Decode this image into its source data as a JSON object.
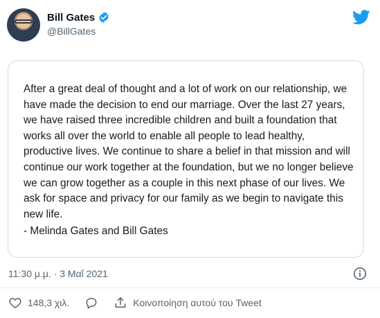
{
  "author": {
    "display_name": "Bill Gates",
    "handle": "@BillGates",
    "verified": true
  },
  "tweet": {
    "statement": "After a great deal of thought and a lot of work on our relationship, we have made the decision to end our marriage. Over the last 27 years, we have raised three incredible children and built a foundation that works all over the world to enable all people to lead healthy, productive lives. We continue to share a belief in that mission and will continue our work together at the foundation, but we no longer believe we can grow together as a couple in this next phase of our lives. We ask for space and privacy for our family as we begin to navigate this new life.",
    "signature": "- Melinda Gates and Bill Gates",
    "timestamp": "11:30 μ.μ. · 3 Μαΐ 2021"
  },
  "actions": {
    "likes": "148,3 χιλ.",
    "share_label": "Κοινοποίηση αυτού του Tweet"
  },
  "colors": {
    "twitter_blue": "#1d9bf0",
    "secondary_text": "#536471",
    "border": "#cfd9de"
  }
}
